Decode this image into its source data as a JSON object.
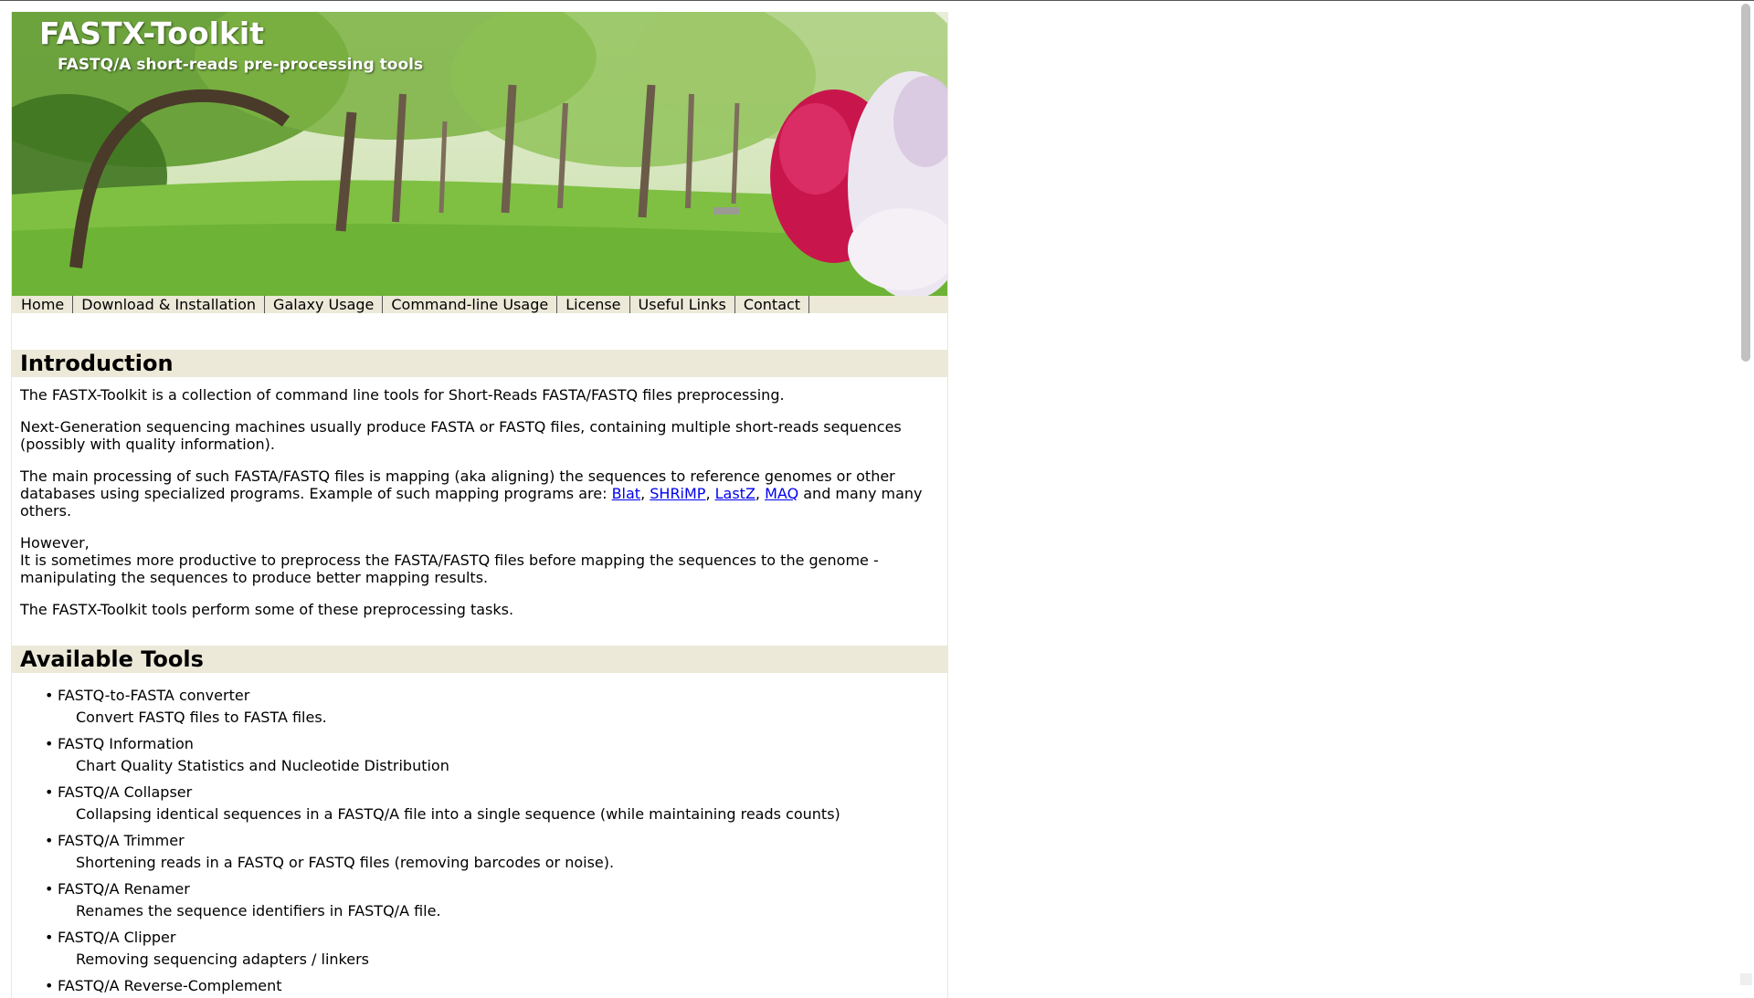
{
  "header": {
    "title": "FASTX-Toolkit",
    "subtitle": "FASTQ/A short-reads pre-processing tools"
  },
  "nav": {
    "items": [
      "Home",
      "Download & Installation",
      "Galaxy Usage",
      "Command-line Usage",
      "License",
      "Useful Links",
      "Contact"
    ]
  },
  "intro": {
    "heading": "Introduction",
    "p1": "The FASTX-Toolkit is a collection of command line tools for Short-Reads FASTA/FASTQ files preprocessing.",
    "p2": "Next-Generation sequencing machines usually produce FASTA or FASTQ files, containing multiple short-reads sequences (possibly with quality information).",
    "p3_before": "The main processing of such FASTA/FASTQ files is mapping (aka aligning) the sequences to reference genomes or other databases using specialized programs. Example of such mapping programs are: ",
    "p3_links": [
      "Blat",
      "SHRiMP",
      "LastZ",
      "MAQ"
    ],
    "p3_sep": ", ",
    "p3_after": " and many many others.",
    "p4_line1": "However,",
    "p4_line2": "It is sometimes more productive to preprocess the FASTA/FASTQ files before mapping the sequences to the genome - manipulating the sequences to produce better mapping results.",
    "p5": "The FASTX-Toolkit tools perform some of these preprocessing tasks."
  },
  "tools": {
    "heading": "Available Tools",
    "bullet": "•",
    "items": [
      {
        "name": "FASTQ-to-FASTA converter",
        "desc": "Convert FASTQ files to FASTA files."
      },
      {
        "name": "FASTQ Information",
        "desc": "Chart Quality Statistics and Nucleotide Distribution"
      },
      {
        "name": "FASTQ/A Collapser",
        "desc": "Collapsing identical sequences in a FASTQ/A file into a single sequence (while maintaining reads counts)"
      },
      {
        "name": "FASTQ/A Trimmer",
        "desc": "Shortening reads in a FASTQ or FASTQ files (removing barcodes or noise)."
      },
      {
        "name": "FASTQ/A Renamer",
        "desc": "Renames the sequence identifiers in FASTQ/A file."
      },
      {
        "name": "FASTQ/A Clipper",
        "desc": "Removing sequencing adapters / linkers"
      },
      {
        "name": "FASTQ/A Reverse-Complement",
        "desc": ""
      }
    ]
  },
  "colors": {
    "nav_bg": "#ece9d8",
    "heading_bg": "#ece9d8",
    "link": "#0000ee",
    "banner_grass": "#84c04a",
    "banner_flowers": "#c8164c"
  }
}
